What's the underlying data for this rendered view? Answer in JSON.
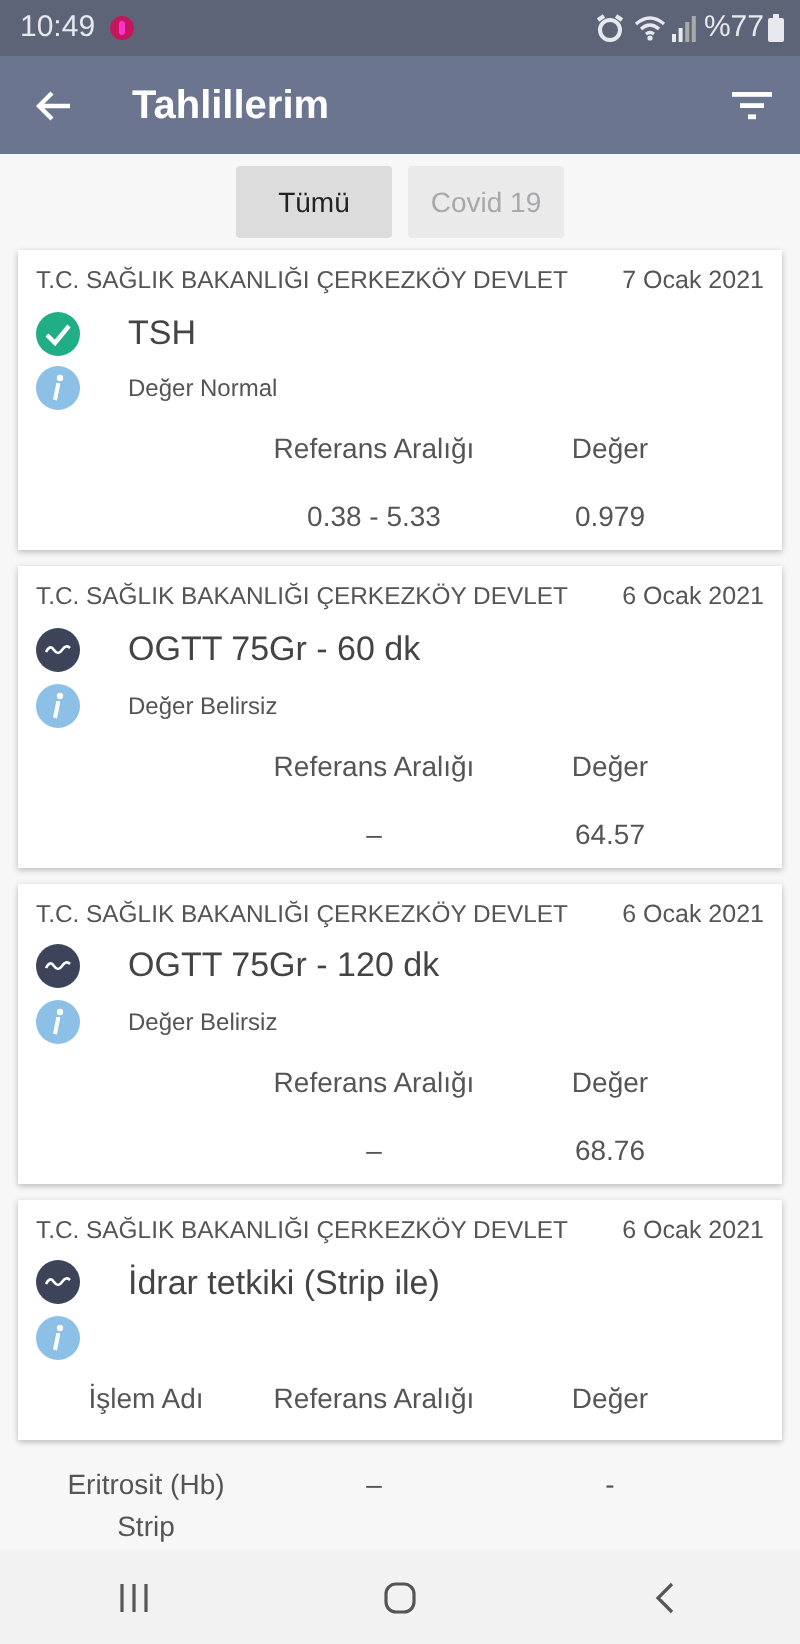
{
  "status_bar": {
    "time": "10:49",
    "battery": "%77"
  },
  "app_bar": {
    "title": "Tahlillerim"
  },
  "tabs": [
    {
      "label": "Tümü",
      "selected": true
    },
    {
      "label": "Covid 19",
      "selected": false
    }
  ],
  "results": [
    {
      "institution": "T.C. SAĞLIK BAKANLIĞI ÇERKEZKÖY DEVLET",
      "date": "7 Ocak 2021",
      "kind": "normal",
      "test": "TSH",
      "note": "Değer Normal",
      "columns": [
        "",
        "Referans Aralığı",
        "Değer"
      ],
      "rows": [
        [
          "",
          "0.38 - 5.33",
          "0.979"
        ]
      ]
    },
    {
      "institution": "T.C. SAĞLIK BAKANLIĞI ÇERKEZKÖY DEVLET",
      "date": "6 Ocak 2021",
      "kind": "unknown",
      "test": "OGTT 75Gr - 60 dk",
      "note": "Değer Belirsiz",
      "columns": [
        "",
        "Referans Aralığı",
        "Değer"
      ],
      "rows": [
        [
          "",
          "–",
          "64.57"
        ]
      ]
    },
    {
      "institution": "T.C. SAĞLIK BAKANLIĞI ÇERKEZKÖY DEVLET",
      "date": "6 Ocak 2021",
      "kind": "unknown",
      "test": "OGTT 75Gr - 120 dk",
      "note": "Değer Belirsiz",
      "columns": [
        "",
        "Referans Aralığı",
        "Değer"
      ],
      "rows": [
        [
          "",
          "–",
          "68.76"
        ]
      ]
    },
    {
      "institution": "T.C. SAĞLIK BAKANLIĞI ÇERKEZKÖY DEVLET",
      "date": "6 Ocak 2021",
      "kind": "unknown",
      "test": "İdrar tetkiki (Strip ile)",
      "columns": [
        "İşlem Adı",
        "Referans Aralığı",
        "Değer"
      ],
      "detail_rows": [
        [
          "Eritrosit (Hb) Strip",
          "–",
          "-"
        ]
      ]
    }
  ]
}
